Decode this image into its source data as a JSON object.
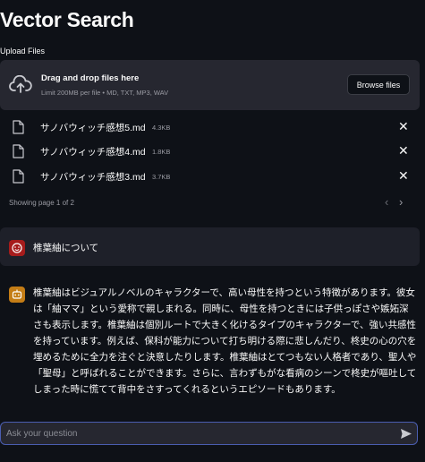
{
  "app": {
    "title": "Vector Search"
  },
  "upload": {
    "label": "Upload Files",
    "drag_text": "Drag and drop files here",
    "limit_text": "Limit 200MB per file • MD, TXT, MP3, WAV",
    "browse_label": "Browse files",
    "icon": "cloud-upload-icon"
  },
  "files": [
    {
      "name": "サノバウィッチ感想5.md",
      "size": "4.3KB",
      "icon": "file-icon"
    },
    {
      "name": "サノバウィッチ感想4.md",
      "size": "1.8KB",
      "icon": "file-icon"
    },
    {
      "name": "サノバウィッチ感想3.md",
      "size": "3.7KB",
      "icon": "file-icon"
    }
  ],
  "pagination": {
    "text": "Showing page 1 of 2"
  },
  "chat": {
    "user_message": "椎葉紬について",
    "assistant_message": "椎葉紬はビジュアルノベルのキャラクターで、高い母性を持つという特徴があります。彼女は「紬ママ」という愛称で親しまれる。同時に、母性を持つときには子供っぽさや嫉妬深さも表示します。椎葉紬は個別ルートで大きく化けるタイプのキャラクターで、強い共感性を持っています。例えば、保科が能力について打ち明ける際に悲しんだり、柊史の心の穴を埋めるために全力を注ぐと決意したりします。椎葉紬はとてつもない人格者であり、聖人や「聖母」と呼ばれることができます。さらに、言わずもがな看病のシーンで柊史が嘔吐してしまった時に慌てて背中をさすってくれるというエピソードもあります。",
    "input_placeholder": "Ask your question"
  },
  "colors": {
    "background": "#0e1117",
    "surface": "#262730",
    "user_avatar": "#a61c1c",
    "assistant_avatar": "#c47d16",
    "input_border": "#4a5db0"
  }
}
